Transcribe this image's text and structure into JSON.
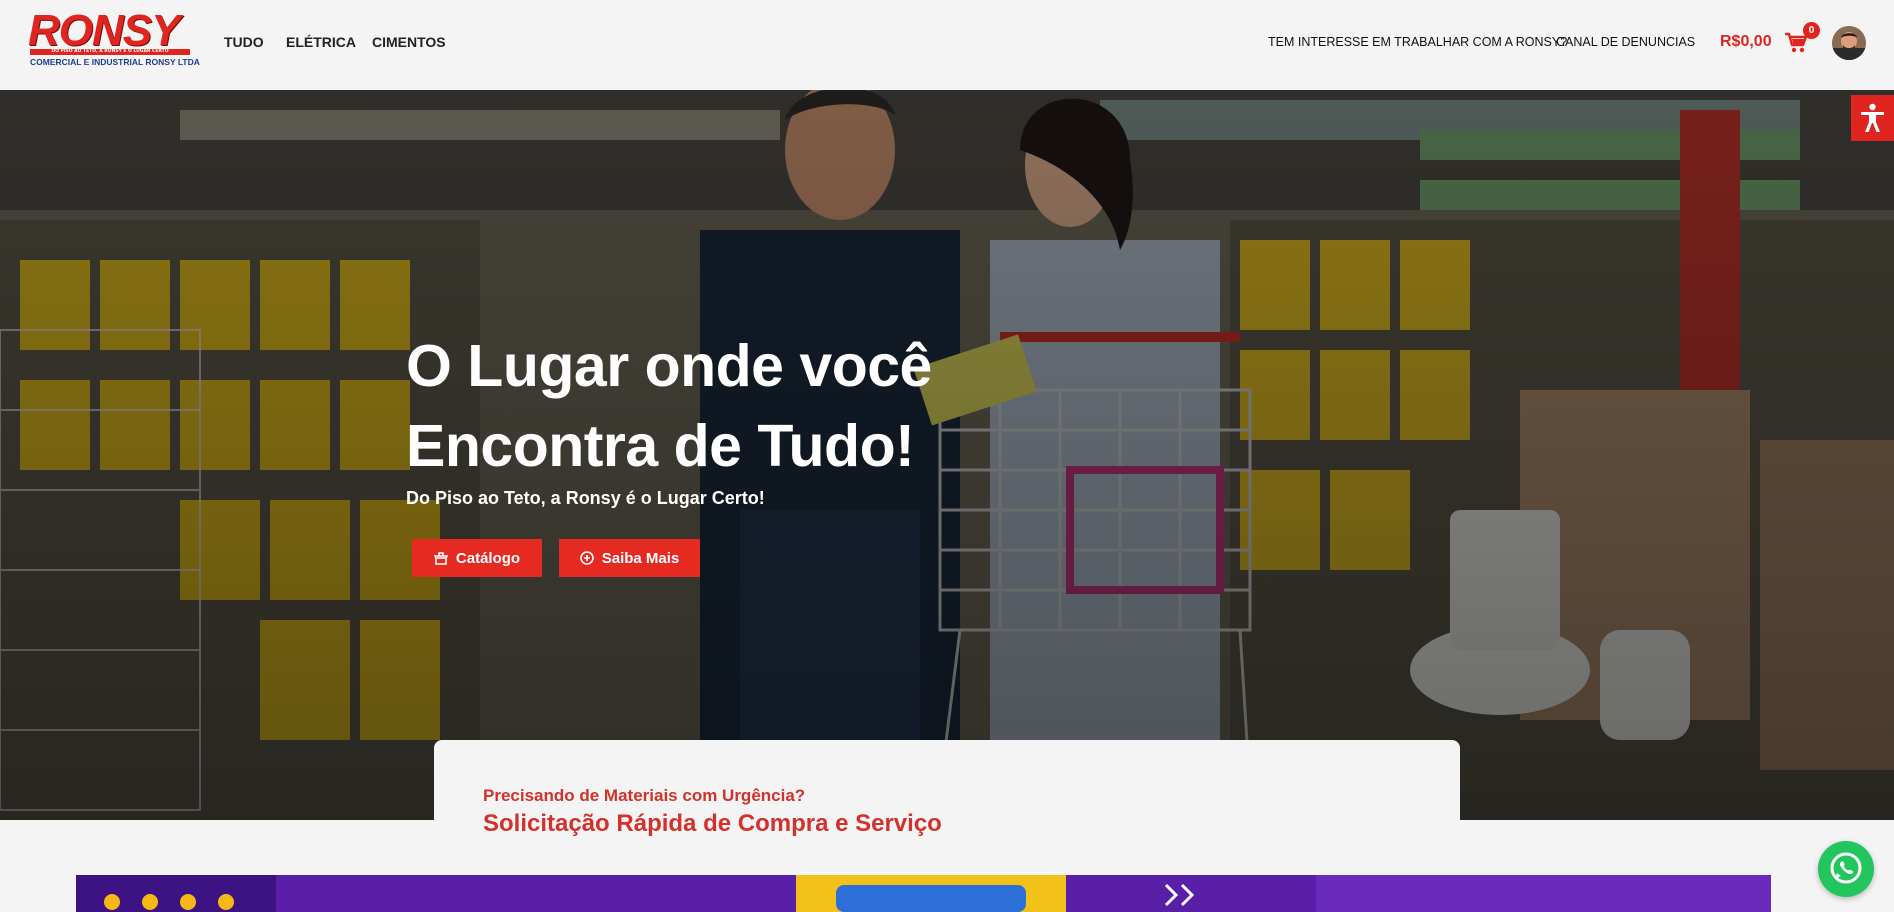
{
  "brand": {
    "logo_word": "RONSY",
    "logo_tagline": "DO PISO AO TETO, A RONSY É O LUGAR CERTO",
    "logo_subtitle": "COMERCIAL E INDUSTRIAL RONSY LTDA"
  },
  "nav": {
    "items": [
      {
        "label": "TUDO"
      },
      {
        "label": "ELÉTRICA"
      },
      {
        "label": "CIMENTOS"
      }
    ],
    "right_links": [
      {
        "label": "TEM INTERESSE EM TRABALHAR COM A RONSY?"
      },
      {
        "label": "CANAL DE DENUNCIAS"
      }
    ],
    "cart_total": "R$0,00",
    "cart_count": "0"
  },
  "hero": {
    "title_line1": "O Lugar onde você",
    "title_line2": "Encontra de Tudo!",
    "subtitle": "Do Piso ao Teto, a Ronsy é o Lugar Certo!",
    "catalog_button": "Catálogo",
    "more_button": "Saiba Mais"
  },
  "quick_request": {
    "kicker": "Precisando de Materiais com Urgência?",
    "title": "Solicitação Rápida de Compra e Serviço"
  },
  "colors": {
    "brand_red": "#e0241f",
    "button_red": "#e52a22",
    "heading_red": "#d2322b",
    "whatsapp_green": "#22c55e",
    "banner_purple": "#5a1fa8"
  },
  "icons": {
    "cart": "shopping-cart-icon",
    "accessibility": "accessibility-icon",
    "whatsapp": "whatsapp-icon",
    "catalog": "store-icon",
    "more": "plus-circle-icon"
  }
}
